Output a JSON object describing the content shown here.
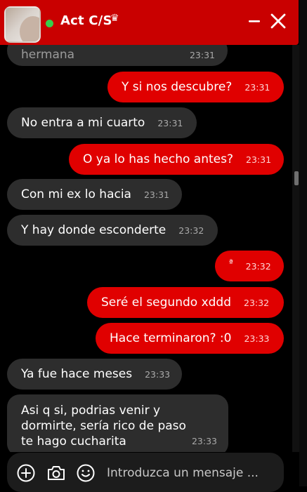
{
  "header": {
    "title": "Act C/S",
    "crown": "♛",
    "online_color": "#35d04b"
  },
  "messages": [
    {
      "side": "in",
      "text": "hermana",
      "time": "23:31"
    },
    {
      "side": "out",
      "text": "Y si nos descubre?",
      "time": "23:31"
    },
    {
      "side": "in",
      "text": "No entra a mi cuarto",
      "time": "23:31"
    },
    {
      "side": "out",
      "text": "O ya lo has hecho antes?",
      "time": "23:31"
    },
    {
      "side": "in",
      "text": "Con mi ex lo hacia",
      "time": "23:31"
    },
    {
      "side": "in",
      "text": "Y hay donde esconderte",
      "time": "23:32"
    },
    {
      "side": "out",
      "text": "ª",
      "time": "23:32"
    },
    {
      "side": "out",
      "text": "Seré el segundo xddd",
      "time": "23:32"
    },
    {
      "side": "out",
      "text": "Hace terminaron? :0",
      "time": "23:33"
    },
    {
      "side": "in",
      "text": "Ya fue hace meses",
      "time": "23:33"
    },
    {
      "side": "in",
      "text": "Asi q si, podrias venir y dormirte, sería rico de paso te hago cucharita",
      "time": "23:33"
    }
  ],
  "composer": {
    "placeholder": "Introduzca un mensaje ..."
  },
  "colors": {
    "header": "#c90000",
    "outgoing": "#e00000",
    "incoming": "#2d2d2d"
  }
}
